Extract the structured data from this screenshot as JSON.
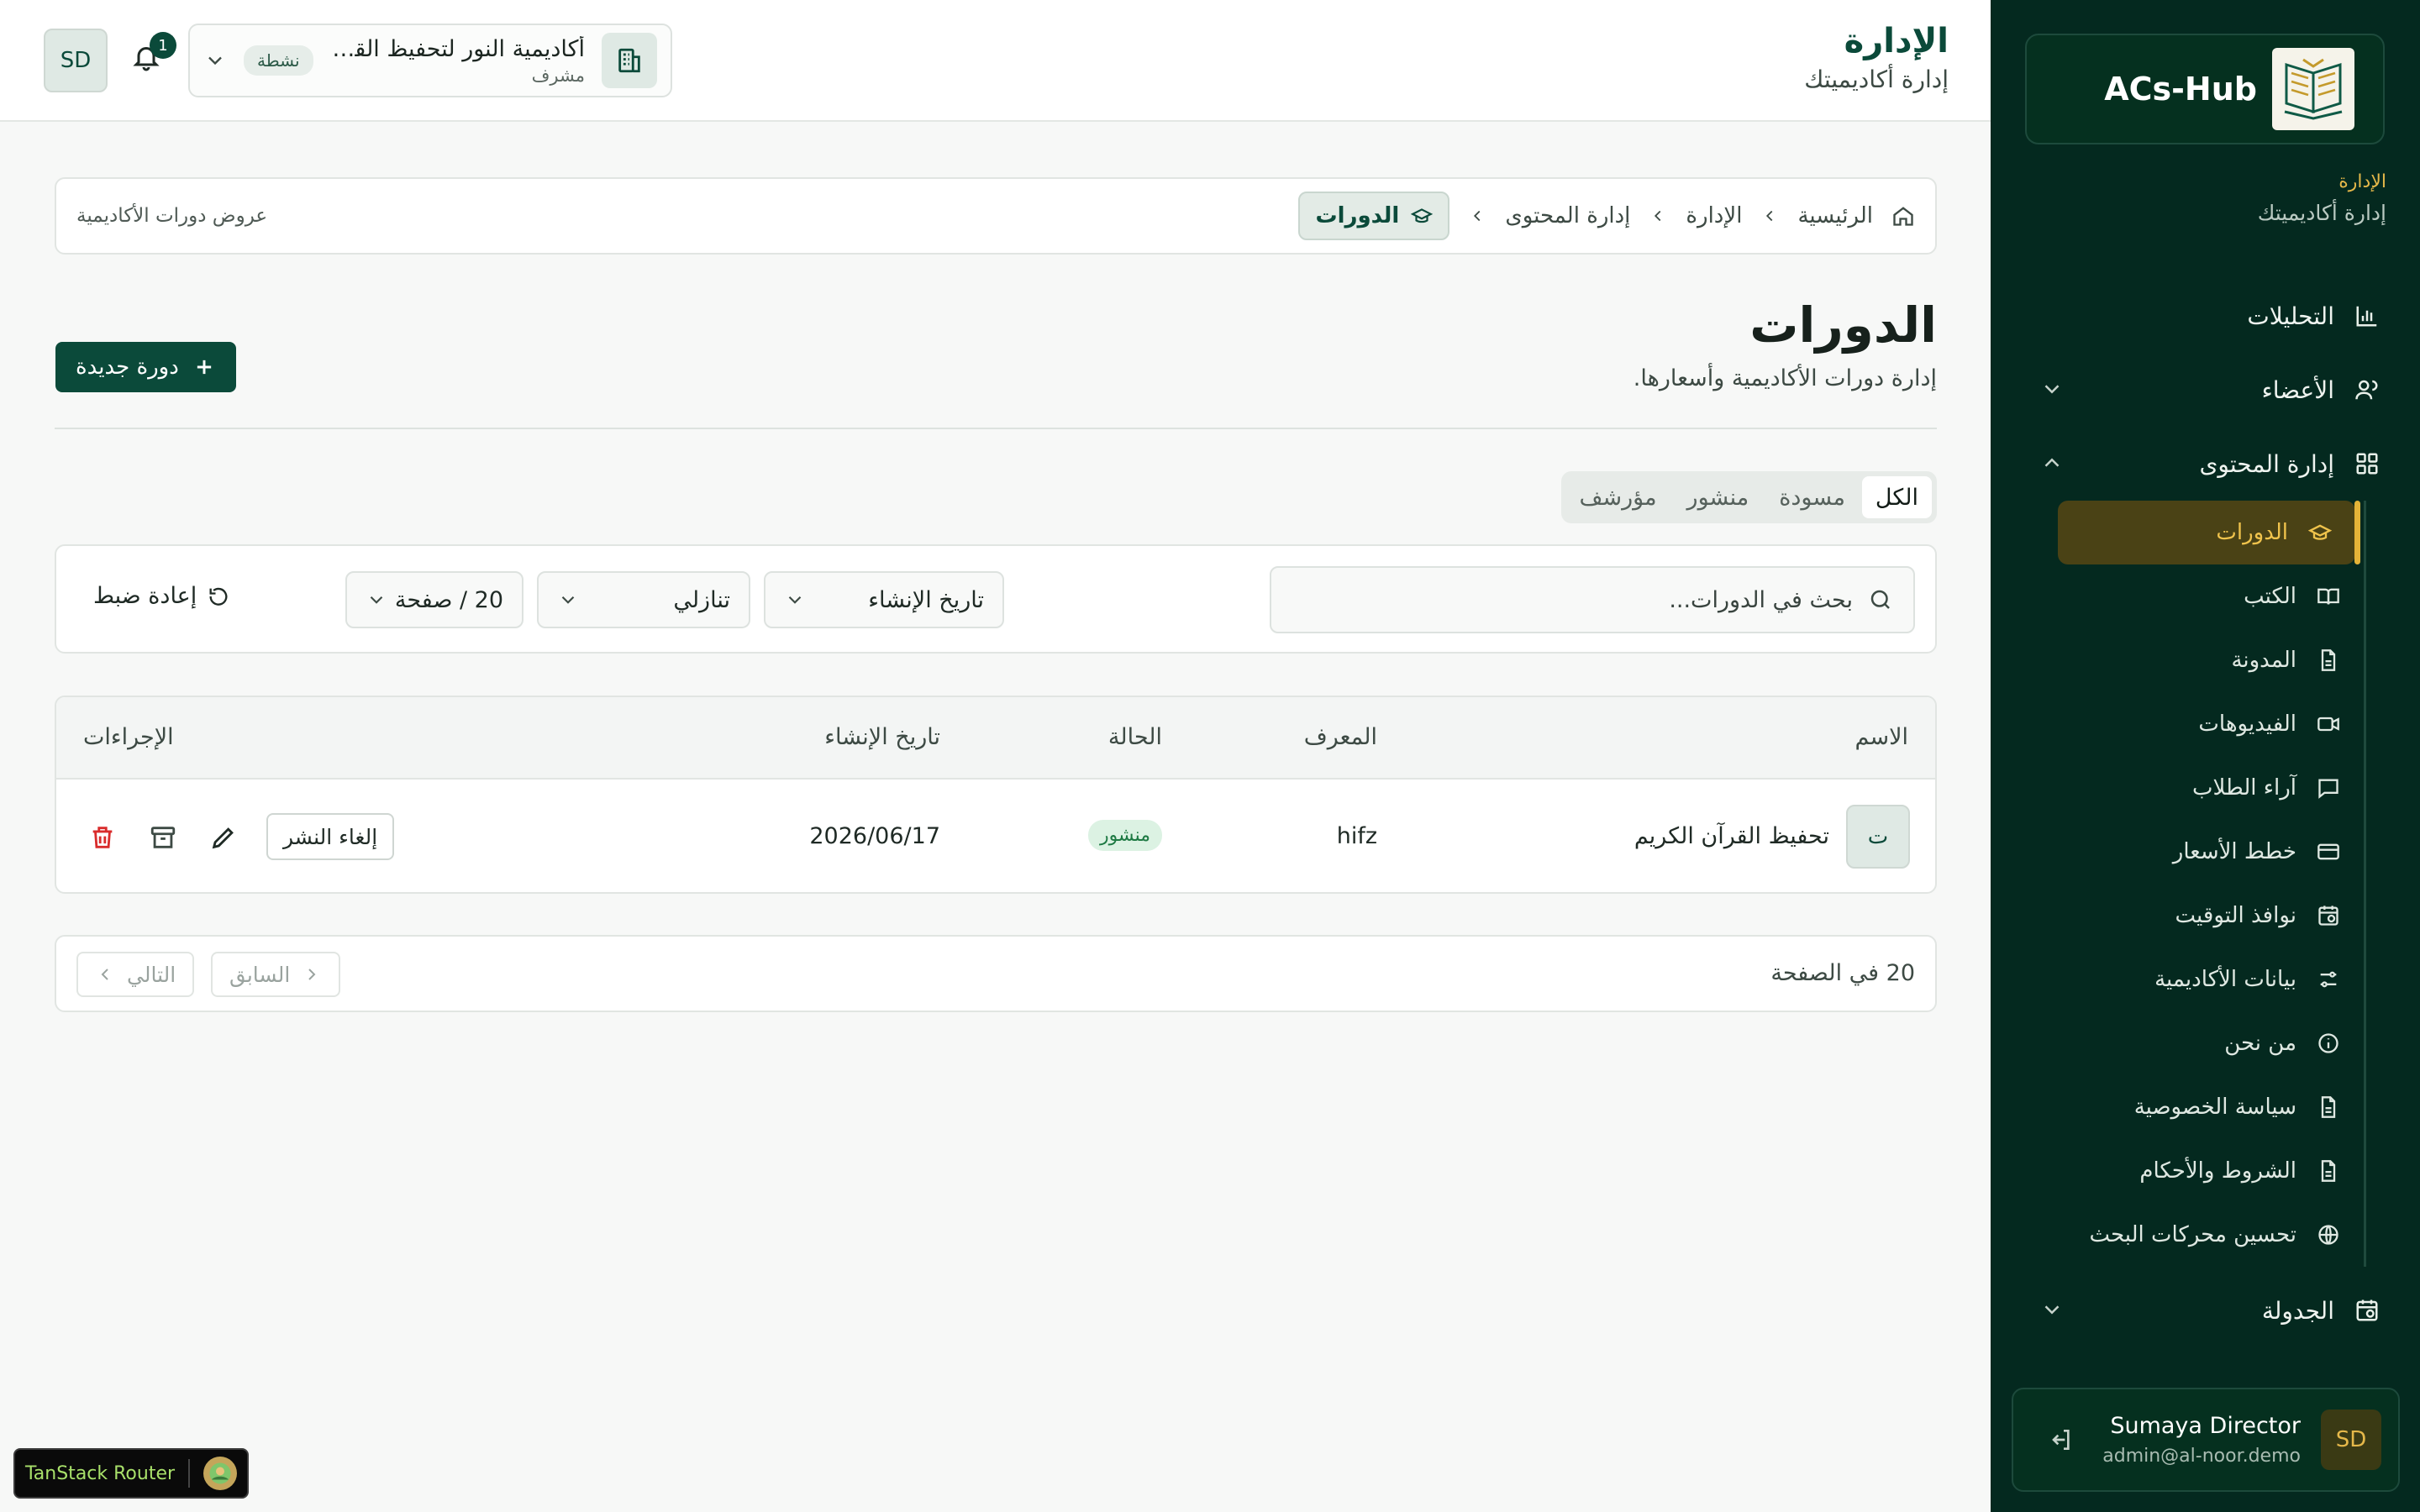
{
  "brand": {
    "name": "ACs-Hub"
  },
  "sidebar": {
    "context_label": "الإدارة",
    "context_sub": "إدارة أكاديميتك",
    "nav": {
      "analytics": "التحليلات",
      "members": "الأعضاء",
      "content": "إدارة المحتوى",
      "scheduling": "الجدولة"
    },
    "sub_items": [
      {
        "label": "الدورات",
        "icon": "graduation-cap-icon"
      },
      {
        "label": "الكتب",
        "icon": "book-icon"
      },
      {
        "label": "المدونة",
        "icon": "file-text-icon"
      },
      {
        "label": "الفيديوهات",
        "icon": "video-icon"
      },
      {
        "label": "آراء الطلاب",
        "icon": "message-icon"
      },
      {
        "label": "خطط الأسعار",
        "icon": "credit-card-icon"
      },
      {
        "label": "نوافذ التوقيت",
        "icon": "calendar-clock-icon"
      },
      {
        "label": "بيانات الأكاديمية",
        "icon": "sliders-icon"
      },
      {
        "label": "من نحن",
        "icon": "info-icon"
      },
      {
        "label": "سياسة الخصوصية",
        "icon": "file-text-icon"
      },
      {
        "label": "الشروط والأحكام",
        "icon": "file-text-icon"
      },
      {
        "label": "تحسين محركات البحث",
        "icon": "globe-icon"
      }
    ],
    "user": {
      "initials": "SD",
      "name": "Sumaya Director",
      "email": "admin@al-noor.demo"
    }
  },
  "header": {
    "title": "الإدارة",
    "subtitle": "إدارة أكاديميتك",
    "academy_name": "أكاديمية النور لتحفيظ القرآن الكريم",
    "academy_role": "مشرف",
    "academy_status": "نشطة",
    "notification_count": "1",
    "avatar_initials": "SD"
  },
  "breadcrumb": {
    "home": "الرئيسية",
    "admin": "الإدارة",
    "content": "إدارة المحتوى",
    "current": "الدورات",
    "description": "عروض دورات الأكاديمية"
  },
  "page": {
    "title": "الدورات",
    "subtitle": "إدارة دورات الأكاديمية وأسعارها.",
    "new_button": "دورة جديدة"
  },
  "tabs": [
    "الكل",
    "مسودة",
    "منشور",
    "مؤرشف"
  ],
  "filters": {
    "search_placeholder": "بحث في الدورات...",
    "sort_field": "تاريخ الإنشاء",
    "sort_order": "تنازلي",
    "page_size": "20 / صفحة",
    "reset": "إعادة ضبط"
  },
  "table": {
    "headers": {
      "name": "الاسم",
      "slug": "المعرف",
      "status": "الحالة",
      "created": "تاريخ الإنشاء",
      "actions": "الإجراءات"
    },
    "rows": [
      {
        "initial": "ت",
        "name": "تحفيظ القرآن الكريم",
        "slug": "hifz",
        "status": "منشور",
        "created": "2026/06/17",
        "unpublish": "إلغاء النشر"
      }
    ]
  },
  "pagination": {
    "per_page": "20 في الصفحة",
    "prev": "السابق",
    "next": "التالي"
  },
  "devtools": {
    "label": "TanStack Router"
  },
  "colors": {
    "sidebar_bg": "#04291f",
    "accent": "#0b4a3a",
    "gold": "#e4b338",
    "published": "#1f7a44",
    "danger": "#d92c2c"
  }
}
